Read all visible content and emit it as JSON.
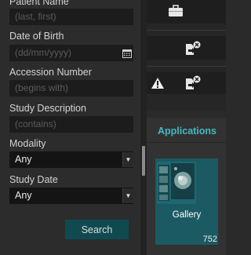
{
  "search_form": {
    "patient_name": {
      "label": "Patient Name",
      "placeholder": "(last, first)",
      "value": ""
    },
    "date_of_birth": {
      "label": "Date of Birth",
      "placeholder": "(dd/mm/yyyy)",
      "value": "",
      "icon": "calendar-icon"
    },
    "accession_number": {
      "label": "Accession Number",
      "placeholder": "(begins with)",
      "value": ""
    },
    "study_description": {
      "label": "Study Description",
      "placeholder": "(contains)",
      "value": ""
    },
    "modality": {
      "label": "Modality",
      "selected": "Any"
    },
    "study_date": {
      "label": "Study Date",
      "selected": "Any"
    },
    "search_button_label": "Search"
  },
  "worklist_rows": [
    {
      "icons": [
        "briefcase-icon"
      ]
    },
    {
      "icons": [
        "send-error-icon"
      ]
    },
    {
      "icons": [
        "warning-icon",
        "send-error-icon"
      ]
    }
  ],
  "applications": {
    "title": "Applications",
    "items": [
      {
        "name": "Gallery",
        "count": "752",
        "icon": "gallery-thumbnail-icon"
      }
    ]
  },
  "colors": {
    "accent": "#45b8c2",
    "button_bg": "#0f4a50",
    "tile_bg": "#1b5a62",
    "panel_bg": "#2c2c2c",
    "input_bg": "#1c1c1c"
  }
}
